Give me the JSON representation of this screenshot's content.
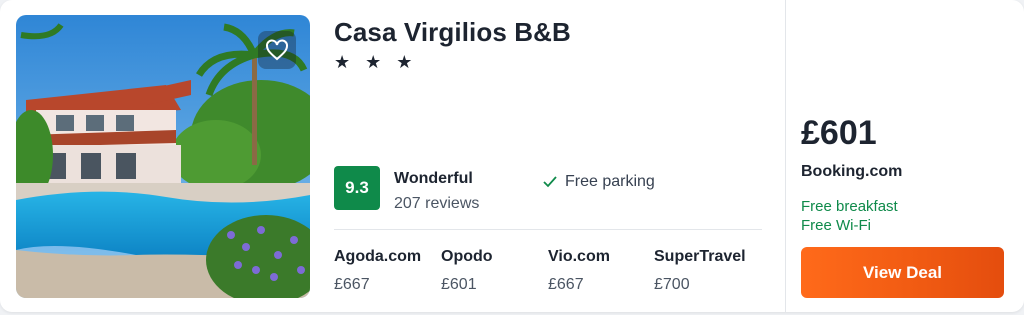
{
  "hotel": {
    "name": "Casa Virgilios B&B",
    "stars": "★ ★ ★",
    "score": "9.3",
    "rating_label": "Wonderful",
    "reviews": "207 reviews",
    "amenity": "Free parking",
    "favorite_icon": "heart-outline-icon"
  },
  "providers": [
    {
      "name": "Agoda.com",
      "price": "£667"
    },
    {
      "name": "Opodo",
      "price": "£601"
    },
    {
      "name": "Vio.com",
      "price": "£667"
    },
    {
      "name": "SuperTravel",
      "price": "£700"
    }
  ],
  "deal": {
    "price": "£601",
    "site": "Booking.com",
    "perks": [
      "Free breakfast",
      "Free Wi-Fi"
    ],
    "button_label": "View Deal"
  },
  "colors": {
    "score_bg": "#0f8a4a",
    "perk_text": "#0f8a4a",
    "cta": "#f05a12"
  }
}
